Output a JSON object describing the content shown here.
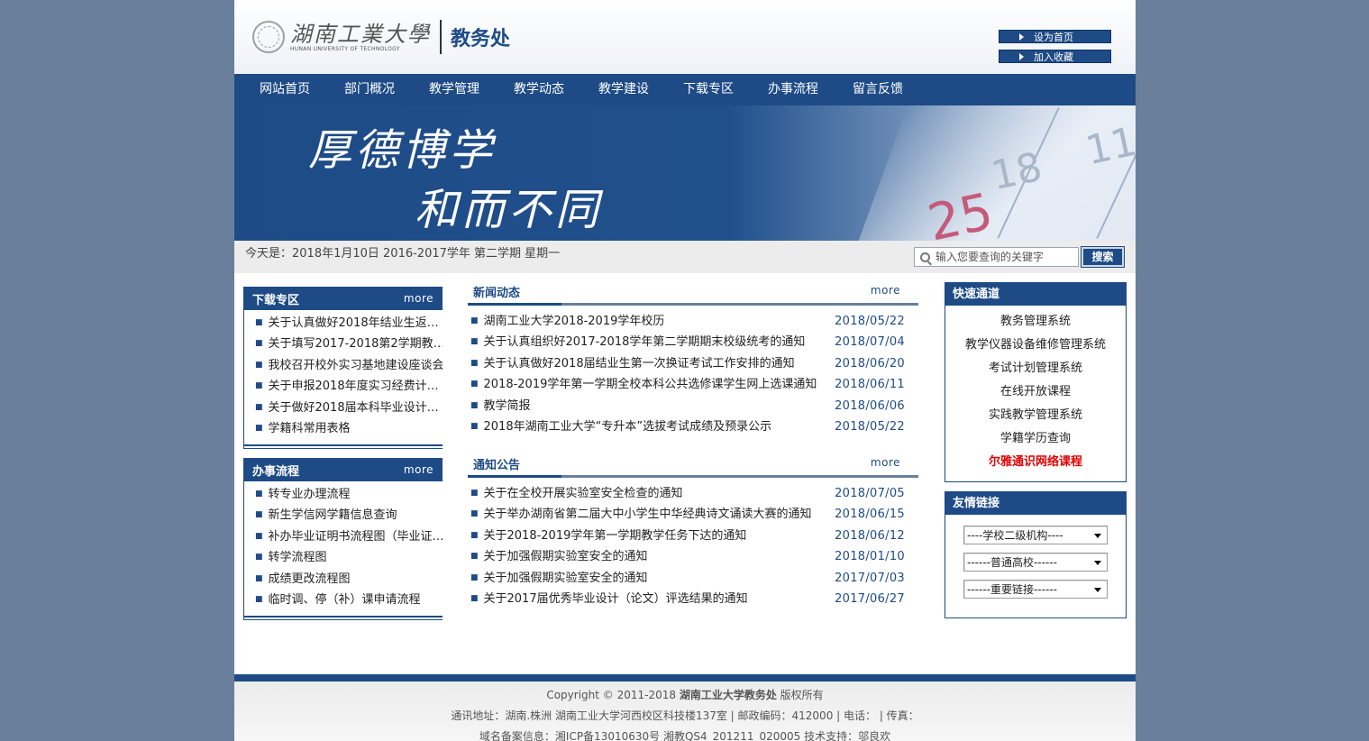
{
  "header": {
    "university_cn": "湖南工業大學",
    "university_en": "HUNAN UNIVERSITY OF TECHNOLOGY",
    "department": "教务处",
    "btn_homepage": "设为首页",
    "btn_favorite": "加入收藏"
  },
  "nav": {
    "items": [
      "网站首页",
      "部门概况",
      "教学管理",
      "教学动态",
      "教学建设",
      "下载专区",
      "办事流程",
      "留言反馈"
    ]
  },
  "banner": {
    "line1": "厚德博学",
    "line2": "和而不同",
    "calendar_numbers": [
      "11",
      "18",
      "25"
    ]
  },
  "infobar": {
    "date_text": "今天是：2018年1月10日 2016-2017学年 第二学期 星期一",
    "search_placeholder": "输入您要查询的关键字",
    "search_button": "搜索"
  },
  "download": {
    "title": "下载专区",
    "more": "more",
    "items": [
      "关于认真做好2018年结业生返…",
      "关于填写2017-2018第2学期教…",
      "我校召开校外实习基地建设座谈会",
      "关于申报2018年度实习经费计…",
      "关于做好2018届本科毕业设计…",
      "学籍科常用表格"
    ]
  },
  "process": {
    "title": "办事流程",
    "more": "more",
    "items": [
      "转专业办理流程",
      "新生学信网学籍信息查询",
      "补办毕业证明书流程图（毕业证…",
      "转学流程图",
      "成绩更改流程图",
      "临时调、停（补）课申请流程"
    ]
  },
  "news": {
    "title": "新闻动态",
    "more": "more",
    "items": [
      {
        "text": "湖南工业大学2018-2019学年校历",
        "date": "2018/05/22"
      },
      {
        "text": "关于认真组织好2017-2018学年第二学期期末校级统考的通知",
        "date": "2018/07/04"
      },
      {
        "text": "关于认真做好2018届结业生第一次换证考试工作安排的通知",
        "date": "2018/06/20"
      },
      {
        "text": "2018-2019学年第一学期全校本科公共选修课学生网上选课通知",
        "date": "2018/06/11"
      },
      {
        "text": "教学简报",
        "date": "2018/06/06"
      },
      {
        "text": "2018年湖南工业大学“专升本”选拔考试成绩及预录公示",
        "date": "2018/05/22"
      }
    ]
  },
  "notice": {
    "title": "通知公告",
    "more": "more",
    "items": [
      {
        "text": "关于在全校开展实验室安全检查的通知",
        "date": "2018/07/05"
      },
      {
        "text": "关于举办湖南省第二届大中小学生中华经典诗文诵读大赛的通知",
        "date": "2018/06/15"
      },
      {
        "text": "关于2018-2019学年第一学期教学任务下达的通知",
        "date": "2018/06/12"
      },
      {
        "text": "关于加强假期实验室安全的通知",
        "date": "2018/01/10"
      },
      {
        "text": "关于加强假期实验室安全的通知",
        "date": "2017/07/03"
      },
      {
        "text": "关于2017届优秀毕业设计（论文）评选结果的通知",
        "date": "2017/06/27"
      }
    ]
  },
  "quick": {
    "title": "快速通道",
    "items": [
      "教务管理系统",
      "教学仪器设备维修管理系统",
      "考试计划管理系统",
      "在线开放课程",
      "实践教学管理系统",
      "学籍学历查询",
      "尔雅通识网络课程"
    ]
  },
  "links": {
    "title": "友情链接",
    "selects": [
      "----学校二级机构----",
      "------普通高校------",
      "------重要链接------"
    ]
  },
  "footer": {
    "copyright_prefix": "Copyright © 2011-2018 ",
    "copyright_owner": "湖南工业大学教务处",
    "copyright_suffix": " 版权所有",
    "address": "通讯地址：湖南.株洲 湖南工业大学河西校区科技楼137室 | 邮政编码：412000 | 电话： | 传真：",
    "icp": "域名备案信息：湘ICP备13010630号 湘教QS4_201211_020005 技术支持：邬良欢"
  },
  "colors": {
    "brand": "#1e4b86",
    "background": "#6a7f9c",
    "highlight": "#e00000"
  }
}
